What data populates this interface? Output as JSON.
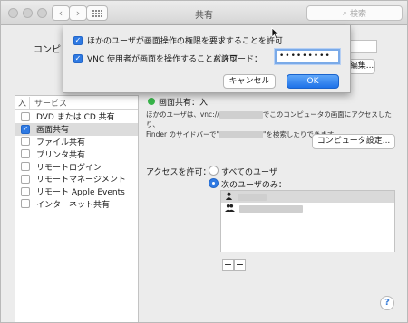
{
  "window": {
    "title": "共有",
    "search_placeholder": "検索"
  },
  "top": {
    "computer_name_label": "コンピュ",
    "edit_label": "編集..."
  },
  "services": {
    "header_on": "入",
    "header_name": "サービス",
    "items": [
      {
        "label": "DVD または CD 共有",
        "checked": false
      },
      {
        "label": "画面共有",
        "checked": true,
        "selected": true
      },
      {
        "label": "ファイル共有",
        "checked": false
      },
      {
        "label": "プリンタ共有",
        "checked": false
      },
      {
        "label": "リモートログイン",
        "checked": false
      },
      {
        "label": "リモートマネージメント",
        "checked": false
      },
      {
        "label": "リモート Apple Events",
        "checked": false
      },
      {
        "label": "インターネット共有",
        "checked": false
      }
    ]
  },
  "detail": {
    "status": "画面共有：入",
    "desc_line1_a": "ほかのユーザは、vnc://",
    "desc_line1_b": "でこのコンピュータの画面にアクセスしたり、",
    "desc_line2_a": "Finder のサイドバーで\"",
    "desc_line2_b": "\"を検索したりできます。",
    "computer_settings_label": "コンピュータ設定...",
    "access_label": "アクセスを許可：",
    "radio_all": "すべてのユーザ",
    "radio_only": "次のユーザのみ：",
    "plus": "+",
    "minus": "−",
    "help": "?"
  },
  "sheet": {
    "option1": "ほかのユーザが画面操作の権限を要求することを許可",
    "option2": "VNC 使用者が画面を操作することを許可",
    "password_label": "パスワード：",
    "password_value": "•••••••••",
    "cancel_label": "キャンセル",
    "ok_label": "OK"
  },
  "colors": {
    "accent": "#2f7ae3",
    "status_on": "#38b54a"
  }
}
